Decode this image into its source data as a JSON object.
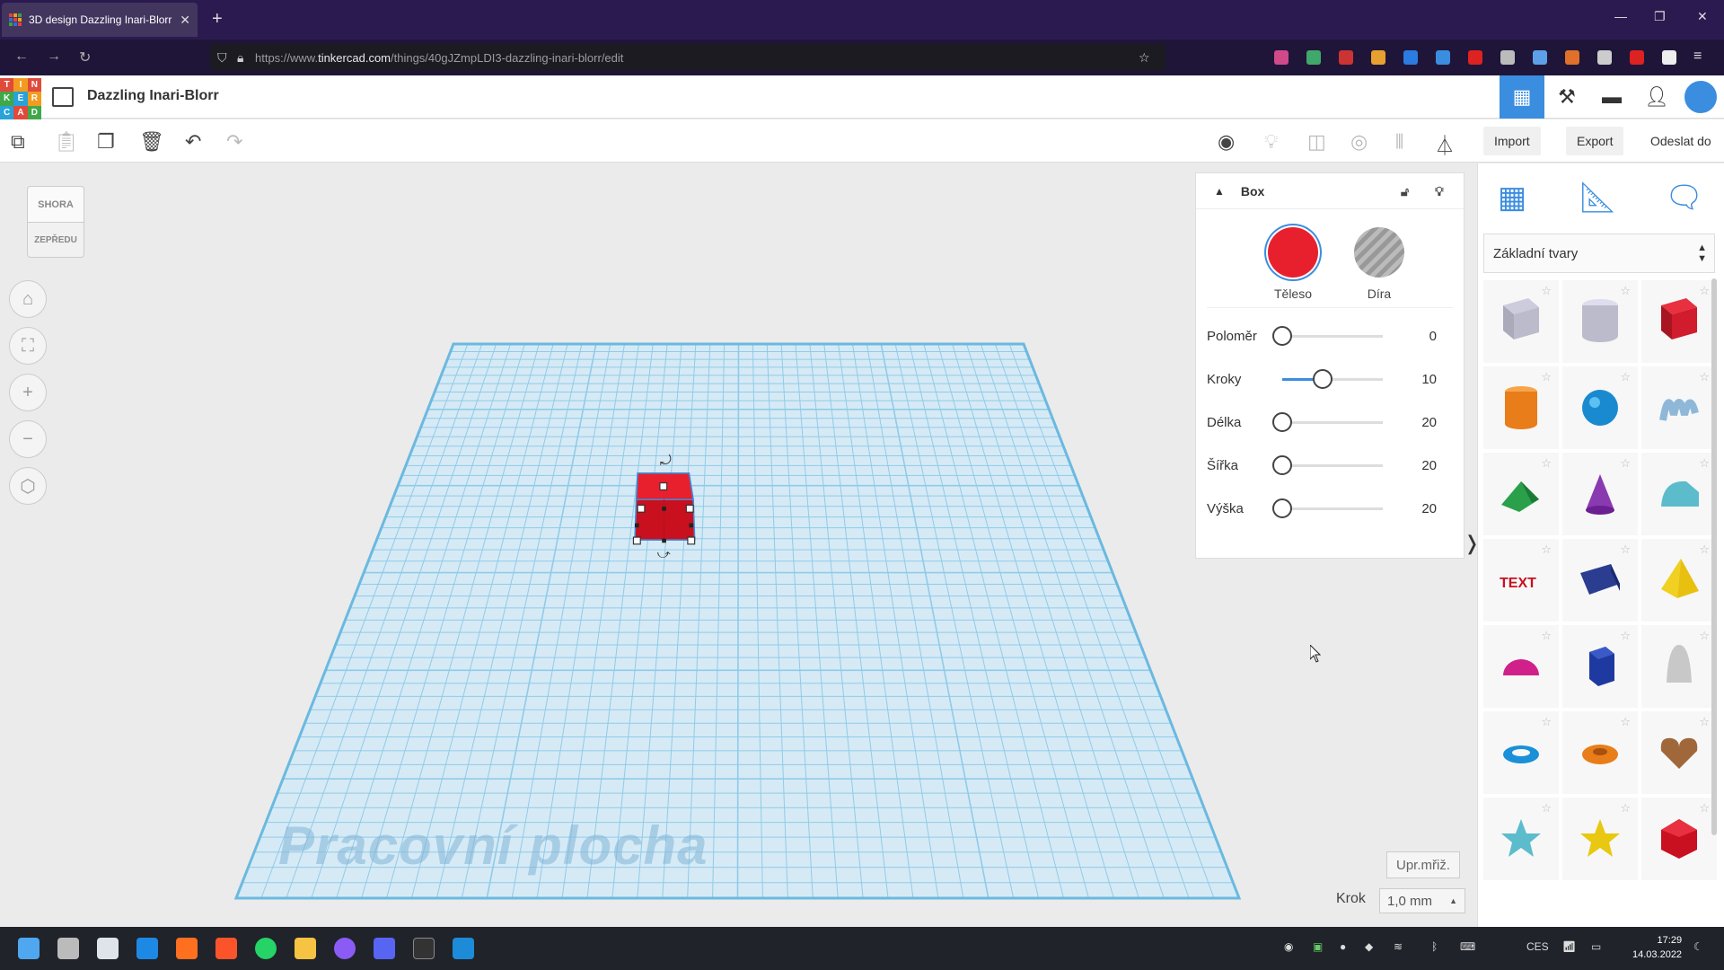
{
  "browser": {
    "tab_title": "3D design Dazzling Inari-Blorr |",
    "url_prefix": "https://www.",
    "url_host": "tinkercad.com",
    "url_path": "/things/40gJZmpLDI3-dazzling-inari-blorr/edit"
  },
  "app": {
    "logo_letters": [
      "T",
      "I",
      "N",
      "K",
      "E",
      "R",
      "C",
      "A",
      "D"
    ],
    "design_name": "Dazzling Inari-Blorr",
    "import_label": "Import",
    "export_label": "Export",
    "send_label": "Odeslat do"
  },
  "viewcube": {
    "top_label": "SHORA",
    "front_label": "ZEPŘEDU"
  },
  "workplane": {
    "label": "Pracovní plocha"
  },
  "inspector": {
    "title": "Box",
    "solid_label": "Těleso",
    "hole_label": "Díra",
    "solid_color": "#e8202e",
    "params": [
      {
        "label": "Poloměr",
        "value": "0"
      },
      {
        "label": "Kroky",
        "value": "10"
      },
      {
        "label": "Délka",
        "value": "20"
      },
      {
        "label": "Šířka",
        "value": "20"
      },
      {
        "label": "Výška",
        "value": "20"
      }
    ],
    "param_levels": [
      0.0,
      0.5,
      0.0,
      0.0,
      0.0
    ]
  },
  "grid": {
    "edit_label": "Upr.mřiž.",
    "step_label": "Krok",
    "step_value": "1,0 mm"
  },
  "shapes_panel": {
    "category": "Základní tvary",
    "shapes": [
      "box-hole",
      "cylinder-hole",
      "box",
      "cylinder",
      "sphere",
      "scribble",
      "roof",
      "cone",
      "round-roof",
      "text",
      "wedge",
      "pyramid",
      "half-sphere",
      "polygon",
      "paraboloid",
      "tube",
      "torus-ring",
      "heart",
      "star",
      "star-yellow",
      "icosahedron"
    ]
  },
  "taskbar": {
    "lang": "CES",
    "time": "17:29",
    "date": "14.03.2022"
  }
}
